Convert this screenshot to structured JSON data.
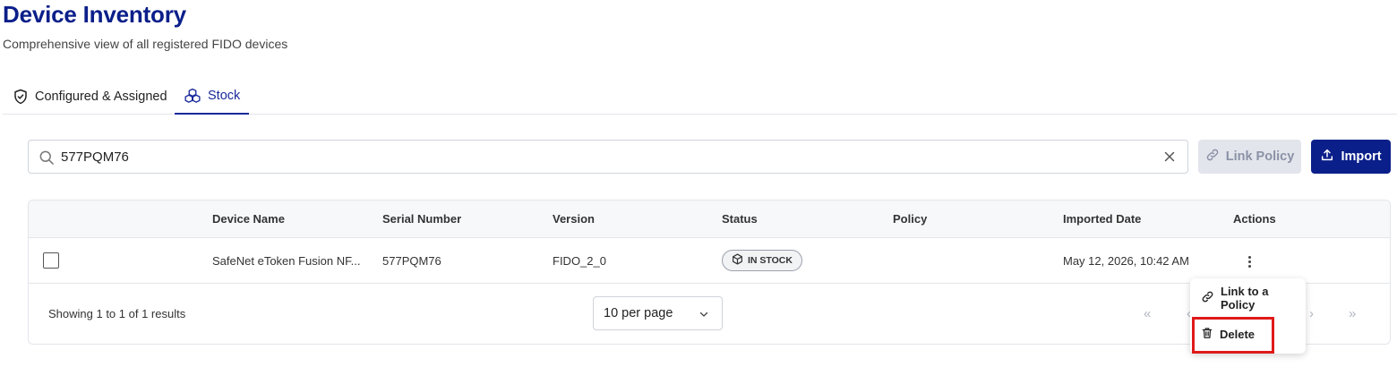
{
  "header": {
    "title": "Device Inventory",
    "subtitle": "Comprehensive view of all registered FIDO devices"
  },
  "tabs": [
    {
      "label": "Configured & Assigned",
      "icon": "shield-check-icon",
      "active": false
    },
    {
      "label": "Stock",
      "icon": "boxes-icon",
      "active": true
    }
  ],
  "search": {
    "value": "577PQM76",
    "placeholder": ""
  },
  "toolbar": {
    "link_policy_label": "Link Policy",
    "import_label": "Import"
  },
  "table": {
    "columns": [
      "",
      "Device Name",
      "Serial Number",
      "Version",
      "Status",
      "Policy",
      "Imported Date",
      "Actions"
    ],
    "rows": [
      {
        "device_name": "SafeNet eToken Fusion NF...",
        "serial_number": "577PQM76",
        "version": "FIDO_2_0",
        "status": "IN STOCK",
        "policy": "",
        "imported_date": "May 12, 2026, 10:42 AM"
      }
    ]
  },
  "footer": {
    "results_text": "Showing 1 to 1 of 1 results",
    "per_page": "10 per page"
  },
  "actions_menu": {
    "items": [
      {
        "label": "Link to a Policy",
        "icon": "link-icon"
      },
      {
        "label": "Delete",
        "icon": "trash-icon"
      }
    ]
  },
  "colors": {
    "brand": "#0b1f8a",
    "highlight": "#e01a1a"
  }
}
